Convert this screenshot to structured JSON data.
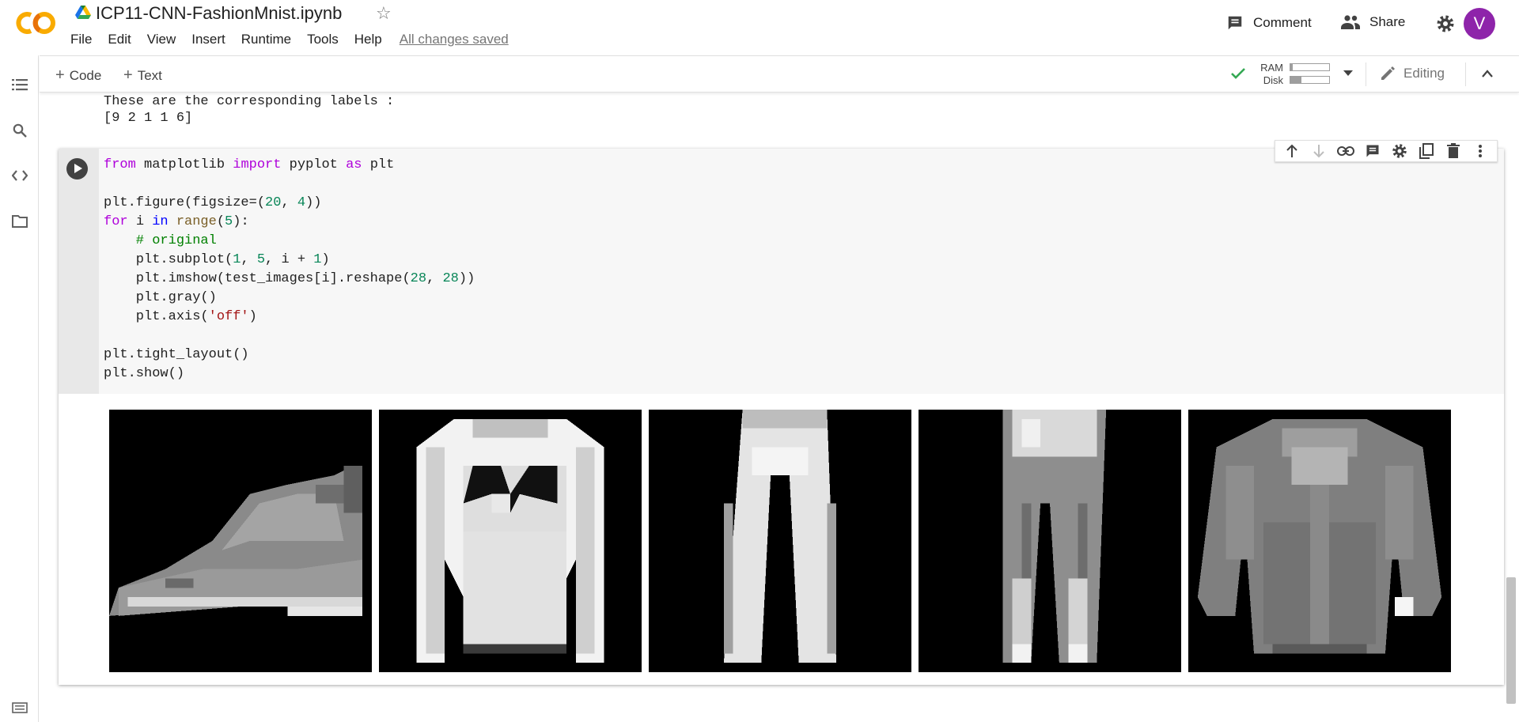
{
  "app": {
    "notebook_title": "ICP11-CNN-FashionMnist.ipynb",
    "avatar_letter": "V",
    "accent_color": "#f9ab00",
    "avatar_color": "#8e24aa"
  },
  "menu": {
    "items": [
      "File",
      "Edit",
      "View",
      "Insert",
      "Runtime",
      "Tools",
      "Help"
    ],
    "saved_status": "All changes saved"
  },
  "header_actions": {
    "comment_label": "Comment",
    "share_label": "Share"
  },
  "toolbar": {
    "add_code_label": "Code",
    "add_text_label": "Text",
    "ram_label": "RAM",
    "disk_label": "Disk",
    "ram_usage_fraction": 0.06,
    "disk_usage_fraction": 0.28,
    "editing_label": "Editing"
  },
  "previous_output": {
    "line1": "These are the corresponding labels :",
    "line2": "[9 2 1 1 6]"
  },
  "cell": {
    "code_lines": [
      "from matplotlib import pyplot as plt",
      "",
      "plt.figure(figsize=(20, 4))",
      "for i in range(5):",
      "    # original",
      "    plt.subplot(1, 5, i + 1)",
      "    plt.imshow(test_images[i].reshape(28, 28))",
      "    plt.gray()",
      "    plt.axis('off')",
      "",
      "plt.tight_layout()",
      "plt.show()"
    ],
    "toolbar_icons": [
      "arrow-up-icon",
      "arrow-down-icon",
      "link-icon",
      "comment-icon",
      "settings-icon",
      "mirror-cell-icon",
      "delete-icon",
      "more-icon"
    ]
  },
  "output_images": [
    {
      "name": "ankle-boot-image",
      "label_index": 9
    },
    {
      "name": "pullover-image",
      "label_index": 2
    },
    {
      "name": "trouser-image",
      "label_index": 1
    },
    {
      "name": "trouser-image-2",
      "label_index": 1
    },
    {
      "name": "shirt-image",
      "label_index": 6
    }
  ]
}
